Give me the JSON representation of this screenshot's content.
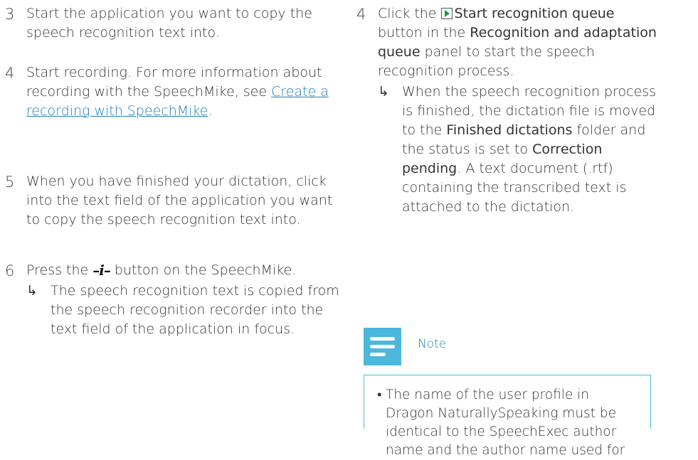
{
  "left": {
    "steps": [
      {
        "num": "3",
        "text": "Start the application you want to copy the speech recognition text into."
      },
      {
        "num": "4",
        "text_before": "Start recording. For more information about recording with the SpeechMike, see ",
        "link": "Create a recording with SpeechMike",
        "text_after": "."
      },
      {
        "num": "5",
        "text": "When you have finished your dictation, click into the text field of the application you want to copy the speech recognition text into."
      },
      {
        "num": "6",
        "text_before": "Press the ",
        "button_symbol": "–i–",
        "text_after": " button on the SpeechMike.",
        "result": "The speech recognition text is copied from the speech recognition recorder into the text field of the application in focus."
      }
    ]
  },
  "right": {
    "step": {
      "num": "4",
      "click": "Click the ",
      "button_label": "Start recognition queue",
      "mid": " button in the ",
      "panel_label": "Recognition and adaptation queue",
      "end": " panel to start the speech recognition process.",
      "result_1": "When the speech recognition process is finished, the dictation file is moved to the ",
      "folder_label": "Finished dictations",
      "result_2": " folder and the status is set to ",
      "status_label": "Correction pending",
      "result_3": ". A text document (.rtf) containing the transcribed text is attached to the dictation."
    },
    "note": {
      "title": "Note",
      "bullet": "•",
      "text": "The name of the user profile in Dragon NaturallySpeaking must be identical to the SpeechExec author name and the author name used for"
    }
  },
  "arrow_symbol": "↳",
  "icons": {
    "play": "play-icon",
    "note": "note-icon"
  },
  "colors": {
    "text": "#333333",
    "link": "#1a80b8",
    "accent": "#4bb8dc"
  }
}
